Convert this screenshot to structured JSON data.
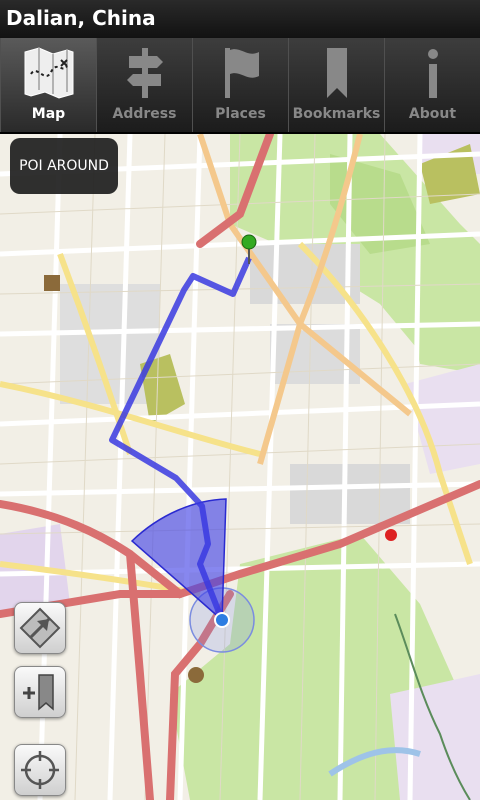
{
  "title": "Dalian, China",
  "tabs": [
    {
      "label": "Map",
      "icon": "map-icon",
      "active": true
    },
    {
      "label": "Address",
      "icon": "signpost-icon"
    },
    {
      "label": "Places",
      "icon": "flag-icon"
    },
    {
      "label": "Bookmarks",
      "icon": "bookmark-icon"
    },
    {
      "label": "About",
      "icon": "info-icon"
    }
  ],
  "poi_button": "POI AROUND",
  "controls": {
    "compass": "compass-icon",
    "add_bookmark": "add-bookmark-icon",
    "locate": "locate-icon"
  },
  "colors": {
    "route": "#3a3ae0",
    "location": "#2d7de2",
    "destination_pin": "#33aa22",
    "marker": "#dd2222",
    "park": "#c9e6a4"
  }
}
